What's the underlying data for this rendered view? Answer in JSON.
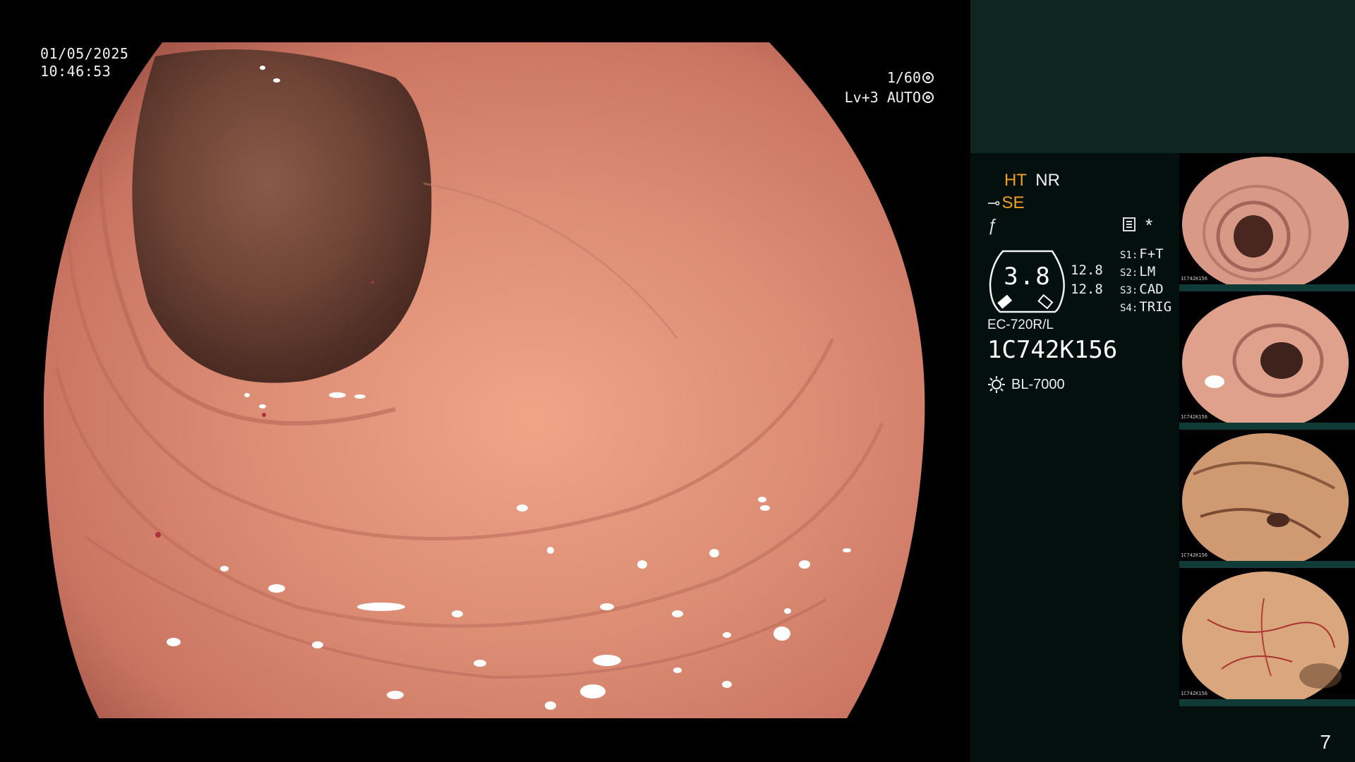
{
  "overlay": {
    "date": "01/05/2025",
    "time": "10:46:53",
    "shutter": "1/60",
    "level": "Lv+3 AUTO"
  },
  "panel": {
    "ht": "HT",
    "nr": "NR",
    "se": "SE",
    "gauge_value": "3.8",
    "gauge_upper": "12.8",
    "gauge_lower": "12.8",
    "switches": [
      {
        "key": "S1:",
        "value": "F+T"
      },
      {
        "key": "S2:",
        "value": "LM"
      },
      {
        "key": "S3:",
        "value": "CAD"
      },
      {
        "key": "S4:",
        "value": "TRIG"
      }
    ],
    "scope_model": "EC-720R/L",
    "scope_serial": "1C742K156",
    "light_source": "BL-7000",
    "thumbnail_serial": "1C742K156",
    "page_number": "7"
  },
  "colors": {
    "accent_orange": "#f0a020",
    "panel_top": "#0e2521",
    "panel_bg": "#03100e",
    "mucosa": "#d58570"
  },
  "icons": {
    "shutter": "aperture-icon",
    "auto": "target-icon",
    "se": "scope-tip-icon",
    "freeze": "slash-f-icon",
    "record": "grid-icon",
    "star": "asterisk-icon",
    "light": "sun-icon"
  }
}
